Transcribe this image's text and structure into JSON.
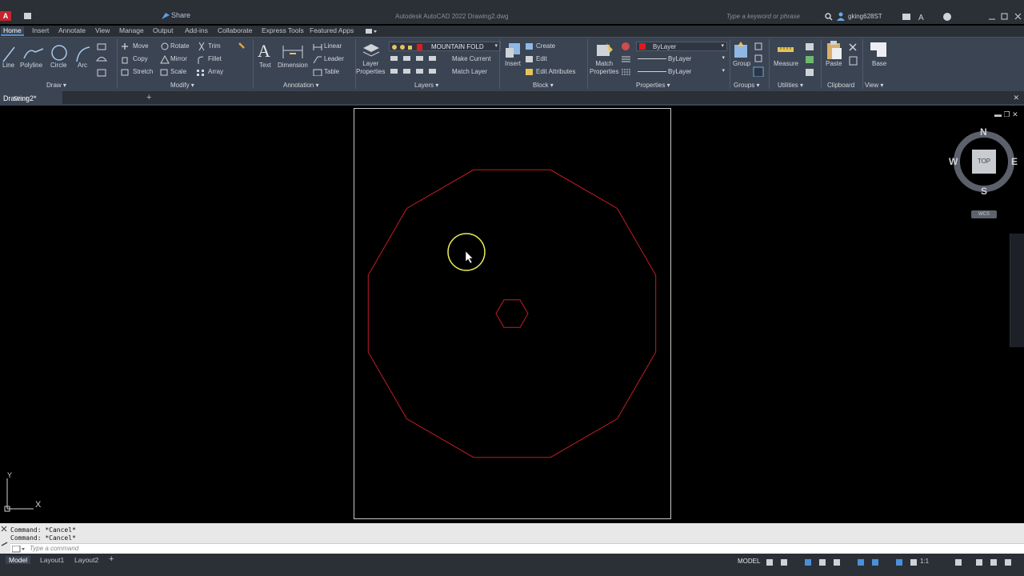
{
  "titlebar": {
    "app_logo": "A",
    "share_label": "Share",
    "title": "Autodesk AutoCAD 2022    Drawing2.dwg",
    "search_placeholder": "Type a keyword or phrase",
    "user": "gking628ST"
  },
  "ribbon_tabs": [
    "Home",
    "Insert",
    "Annotate",
    "View",
    "Manage",
    "Output",
    "Add-ins",
    "Collaborate",
    "Express Tools",
    "Featured Apps"
  ],
  "ribbon": {
    "draw": {
      "line": "Line",
      "polyline": "Polyline",
      "circle": "Circle",
      "arc": "Arc",
      "panel": "Draw ▾"
    },
    "modify": {
      "move": "Move",
      "rotate": "Rotate",
      "trim": "Trim",
      "copy": "Copy",
      "mirror": "Mirror",
      "fillet": "Fillet",
      "stretch": "Stretch",
      "scale": "Scale",
      "array": "Array",
      "panel": "Modify ▾"
    },
    "annotation": {
      "text": "Text",
      "dimension": "Dimension",
      "linear": "Linear",
      "leader": "Leader",
      "table": "Table",
      "panel": "Annotation ▾"
    },
    "layers": {
      "layer_properties": "Layer\nProperties",
      "current_layer": "MOUNTAIN FOLD",
      "make_current": "Make Current",
      "match_layer": "Match Layer",
      "panel": "Layers ▾"
    },
    "block": {
      "insert": "Insert",
      "create": "Create",
      "edit": "Edit",
      "edit_attributes": "Edit Attributes",
      "panel": "Block ▾"
    },
    "properties": {
      "match_properties": "Match\nProperties",
      "color": "ByLayer",
      "linetype": "ByLayer",
      "lineweight": "ByLayer",
      "panel": "Properties ▾"
    },
    "groups": {
      "group": "Group",
      "panel": "Groups ▾"
    },
    "utilities": {
      "measure": "Measure",
      "panel": "Utilities ▾"
    },
    "clipboard": {
      "paste": "Paste",
      "panel": "Clipboard"
    },
    "view": {
      "base": "Base",
      "panel": "View ▾"
    },
    "colors": {
      "layer_swatch": "#e01b1b",
      "accent": "#4a90d9"
    }
  },
  "doc_tabs": {
    "start": "Start",
    "drawing": "Drawing2*"
  },
  "viewcube": {
    "n": "N",
    "s": "S",
    "e": "E",
    "w": "W",
    "top": "TOP",
    "wcs": "WCS"
  },
  "ucs": {
    "x": "X",
    "y": "Y"
  },
  "command": {
    "history": [
      "Command: *Cancel*",
      "Command: *Cancel*"
    ],
    "placeholder": "Type a command"
  },
  "status": {
    "tabs": [
      "Model",
      "Layout1",
      "Layout2"
    ],
    "model_label": "MODEL",
    "scale": "1:1"
  },
  "drawing": {
    "line_color": "#c41d24",
    "outer_polygon_sides": 12,
    "inner_polygon_sides": 6
  }
}
